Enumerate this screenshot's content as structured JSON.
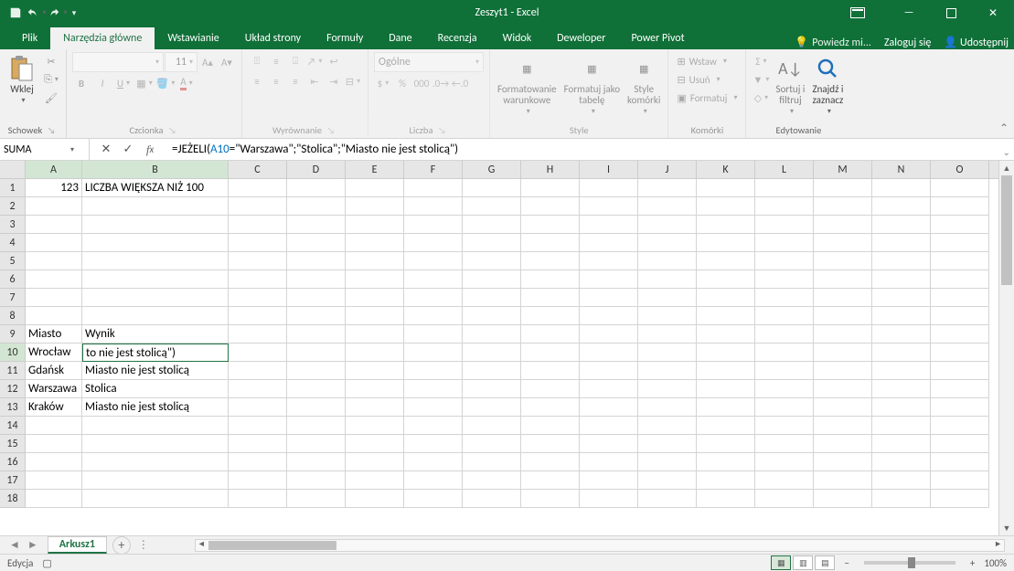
{
  "title": "Zeszyt1 - Excel",
  "tabs": {
    "file": "Plik",
    "home": "Narzędzia główne",
    "insert": "Wstawianie",
    "layout": "Układ strony",
    "formulas": "Formuły",
    "data": "Dane",
    "review": "Recenzja",
    "view": "Widok",
    "developer": "Deweloper",
    "powerpivot": "Power Pivot"
  },
  "tell_me": "Powiedz mi...",
  "sign_in": "Zaloguj się",
  "share": "Udostępnij",
  "groups": {
    "clipboard": "Schowek",
    "paste": "Wklej",
    "font": "Czcionka",
    "font_size": "11",
    "alignment": "Wyrównanie",
    "number": "Liczba",
    "number_format": "Ogólne",
    "styles": "Style",
    "cond_format": "Formatowanie\nwarunkowe",
    "format_table": "Formatuj jako\ntabelę",
    "cell_styles": "Style\nkomórki",
    "cells": "Komórki",
    "insert_btn": "Wstaw",
    "delete_btn": "Usuń",
    "format_btn": "Formatuj",
    "editing": "Edytowanie",
    "sort_filter": "Sortuj i\nfiltruj",
    "find_select": "Znajdź i\nzaznacz"
  },
  "namebox": "SUMA",
  "formula": {
    "pre": "=JEŻELI(",
    "ref": "A10",
    "post": "=\"Warszawa\";\"Stolica\";\"Miasto nie jest stolicą\")"
  },
  "columns": [
    "A",
    "B",
    "C",
    "D",
    "E",
    "F",
    "G",
    "H",
    "I",
    "J",
    "K",
    "L",
    "M",
    "N",
    "O"
  ],
  "rows": [
    1,
    2,
    3,
    4,
    5,
    6,
    7,
    8,
    9,
    10,
    11,
    12,
    13,
    14,
    15,
    16,
    17,
    18
  ],
  "cells": {
    "A1": "123",
    "B1": "LICZBA WIĘKSZA NIŻ 100",
    "A9": "Miasto",
    "B9": "Wynik",
    "A10": "Wrocław",
    "B10": "to nie jest stolicą\")",
    "A11": "Gdańsk",
    "B11": "Miasto nie jest stolicą",
    "A12": "Warszawa",
    "B12": "Stolica",
    "A13": "Kraków",
    "B13": "Miasto nie jest stolicą"
  },
  "sheet_tab": "Arkusz1",
  "status_mode": "Edycja",
  "zoom": "100%"
}
